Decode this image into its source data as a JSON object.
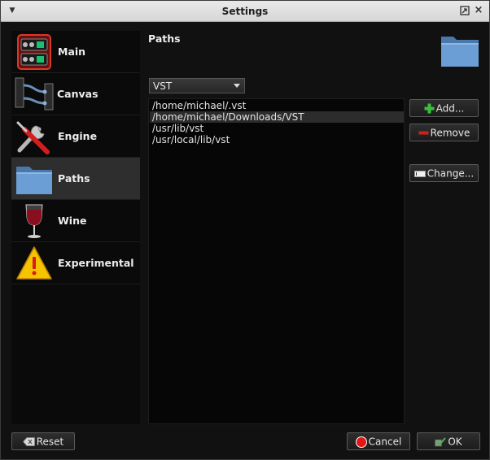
{
  "window": {
    "title": "Settings"
  },
  "sidebar": {
    "items": [
      {
        "label": "Main",
        "icon": "main-panel-icon",
        "selected": false
      },
      {
        "label": "Canvas",
        "icon": "canvas-cables-icon",
        "selected": false
      },
      {
        "label": "Engine",
        "icon": "engine-tools-icon",
        "selected": false
      },
      {
        "label": "Paths",
        "icon": "folder-icon",
        "selected": true
      },
      {
        "label": "Wine",
        "icon": "wine-glass-icon",
        "selected": false
      },
      {
        "label": "Experimental",
        "icon": "warning-icon",
        "selected": false
      }
    ]
  },
  "paths_page": {
    "title": "Paths",
    "type_select": {
      "value": "VST"
    },
    "paths": [
      {
        "text": "/home/michael/.vst",
        "selected": false
      },
      {
        "text": "/home/michael/Downloads/VST",
        "selected": true
      },
      {
        "text": "/usr/lib/vst",
        "selected": false
      },
      {
        "text": "/usr/local/lib/vst",
        "selected": false
      }
    ],
    "add_label": "Add...",
    "remove_label": "Remove",
    "change_label": "Change..."
  },
  "footer": {
    "reset_label": "Reset",
    "cancel_label": "Cancel",
    "ok_label": "OK"
  },
  "colors": {
    "background": "#111111",
    "selected_item": "#2e2e2e",
    "folder_blue": "#5b8ec9"
  }
}
